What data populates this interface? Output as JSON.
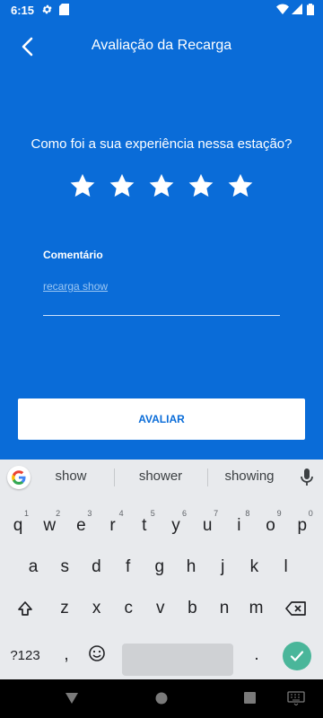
{
  "status_bar": {
    "time": "6:15"
  },
  "app_bar": {
    "title": "Avaliação da Recarga"
  },
  "rating": {
    "question": "Como foi a sua experiência nessa estação?",
    "stars_total": 5
  },
  "comment": {
    "label": "Comentário",
    "value": "recarga show"
  },
  "submit": {
    "label": "AVALIAR"
  },
  "keyboard": {
    "suggestions": [
      "show",
      "shower",
      "showing"
    ],
    "row1": [
      {
        "k": "q",
        "h": "1"
      },
      {
        "k": "w",
        "h": "2"
      },
      {
        "k": "e",
        "h": "3"
      },
      {
        "k": "r",
        "h": "4"
      },
      {
        "k": "t",
        "h": "5"
      },
      {
        "k": "y",
        "h": "6"
      },
      {
        "k": "u",
        "h": "7"
      },
      {
        "k": "i",
        "h": "8"
      },
      {
        "k": "o",
        "h": "9"
      },
      {
        "k": "p",
        "h": "0"
      }
    ],
    "row2": [
      "a",
      "s",
      "d",
      "f",
      "g",
      "h",
      "j",
      "k",
      "l"
    ],
    "row3": [
      "z",
      "x",
      "c",
      "v",
      "b",
      "n",
      "m"
    ],
    "symbols_key": "?123",
    "comma_key": ",",
    "period_key": "."
  },
  "colors": {
    "primary": "#0a6cd8",
    "keyboard_bg": "#e8eaed",
    "enter": "#4ab69a"
  }
}
